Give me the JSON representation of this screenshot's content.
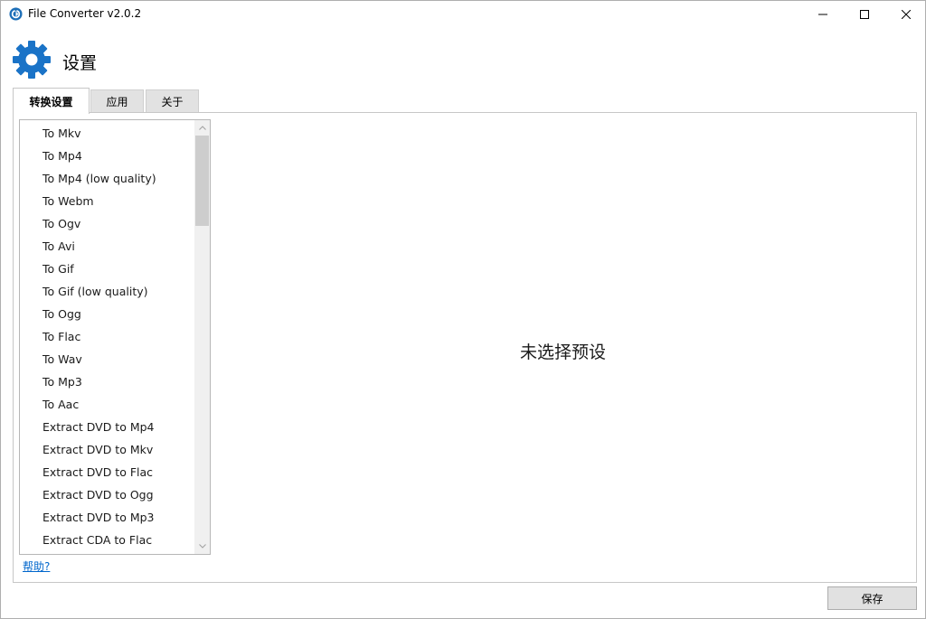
{
  "window": {
    "title": "File Converter v2.0.2",
    "controls": {
      "minimize": "minimize-icon",
      "maximize": "maximize-icon",
      "close": "close-icon"
    }
  },
  "header": {
    "icon": "gear-icon",
    "title": "设置",
    "accent": "#1a73c7"
  },
  "tabs": [
    {
      "label": "转换设置",
      "selected": true
    },
    {
      "label": "应用",
      "selected": false
    },
    {
      "label": "关于",
      "selected": false
    }
  ],
  "preset_list": {
    "items": [
      "To Mkv",
      "To Mp4",
      "To Mp4 (low quality)",
      "To Webm",
      "To Ogv",
      "To Avi",
      "To Gif",
      "To Gif (low quality)",
      "To Ogg",
      "To Flac",
      "To Wav",
      "To Mp3",
      "To Aac",
      "Extract DVD to Mp4",
      "Extract DVD to Mkv",
      "Extract DVD to Flac",
      "Extract DVD to Ogg",
      "Extract DVD to Mp3",
      "Extract CDA to Flac"
    ]
  },
  "help_link": "帮助?",
  "empty_message": "未选择预设",
  "footer": {
    "save_label": "保存"
  },
  "colors": {
    "link": "#0066cc",
    "tab_inactive": "#e2e2e2",
    "button_bg": "#e1e1e1"
  }
}
